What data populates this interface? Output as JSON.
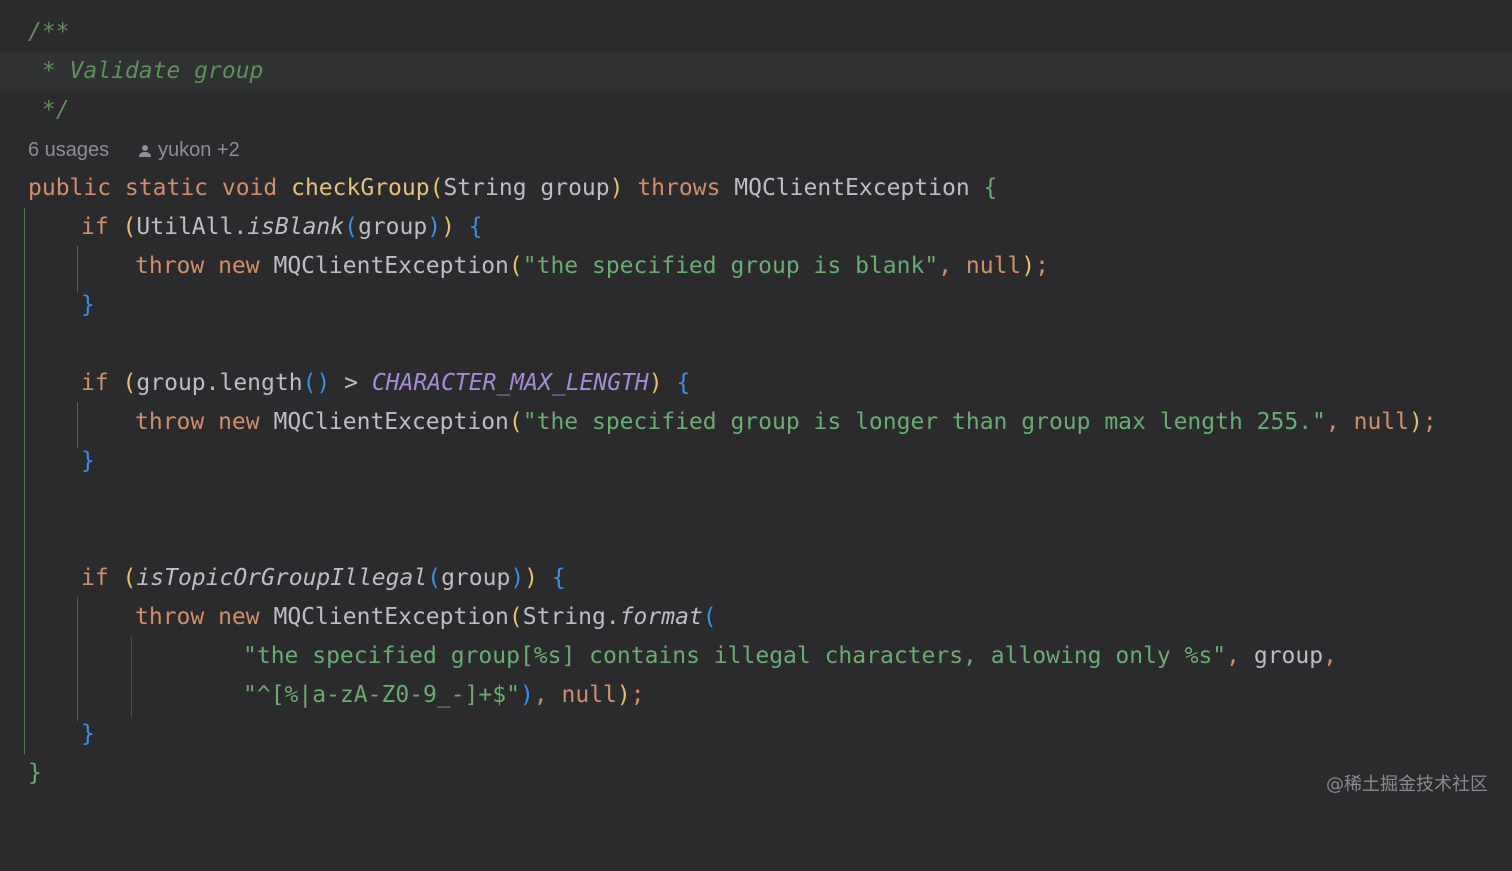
{
  "editor": {
    "doc_open": "/**",
    "doc_text": " * Validate group",
    "doc_close": " */",
    "inlay": {
      "usages": "6 usages",
      "author": "yukon +2"
    },
    "lines": {
      "sig": {
        "t1": "public static void ",
        "t2": "checkGroup",
        "t3": "(",
        "t4": "String group",
        "t5": ") ",
        "t6": "throws ",
        "t7": "MQClientException ",
        "t8": "{"
      },
      "if1": {
        "t1": "if ",
        "t2": "(",
        "t3": "UtilAll.",
        "t4": "isBlank",
        "t5": "(",
        "t6": "group",
        "t7": ")",
        "t8": ")",
        "t9": " {"
      },
      "throw1": {
        "t1": "throw new ",
        "t2": "MQClientException",
        "t3": "(",
        "t4": "\"the specified group is blank\"",
        "t5": ", ",
        "t6": "null",
        "t7": ")",
        "t8": ";"
      },
      "close1": "}",
      "if2": {
        "t1": "if ",
        "t2": "(",
        "t3": "group.length",
        "t4": "()",
        "t5": " > ",
        "t6": "CHARACTER_MAX_LENGTH",
        "t7": ")",
        "t8": " {"
      },
      "throw2": {
        "t1": "throw new ",
        "t2": "MQClientException",
        "t3": "(",
        "t4": "\"the specified group is longer than group max length 255.\"",
        "t5": ", ",
        "t6": "null",
        "t7": ")",
        "t8": ";"
      },
      "close2": "}",
      "if3": {
        "t1": "if ",
        "t2": "(",
        "t3": "isTopicOrGroupIllegal",
        "t4": "(",
        "t5": "group",
        "t6": ")",
        "t7": ")",
        "t8": " {"
      },
      "throw3": {
        "t1": "throw new ",
        "t2": "MQClientException",
        "t3": "(",
        "t4": "String.",
        "t5": "format",
        "t6": "("
      },
      "fmt1": {
        "t1": "\"the specified group[%s] contains illegal characters, allowing only %s\"",
        "t2": ", ",
        "t3": "group",
        "t4": ","
      },
      "fmt2": {
        "t1": "\"^[%|a-zA-Z0-9_-]+$\"",
        "t2": ")",
        "t3": ", ",
        "t4": "null",
        "t5": ")",
        "t6": ";"
      },
      "close3": "}",
      "close_method": "}"
    }
  },
  "watermark": "@稀土掘金技术社区",
  "colors": {
    "background": "#2b2b2d",
    "keyword": "#cf8e6d",
    "method_decl": "#e6c07b",
    "string": "#6aab73",
    "doc_comment": "#5f8f5b",
    "constant": "#a58ad6",
    "bracket_level1": "#e8bf6a",
    "bracket_level2": "#3d8fe8",
    "bracket_level3": "#6aab73"
  }
}
